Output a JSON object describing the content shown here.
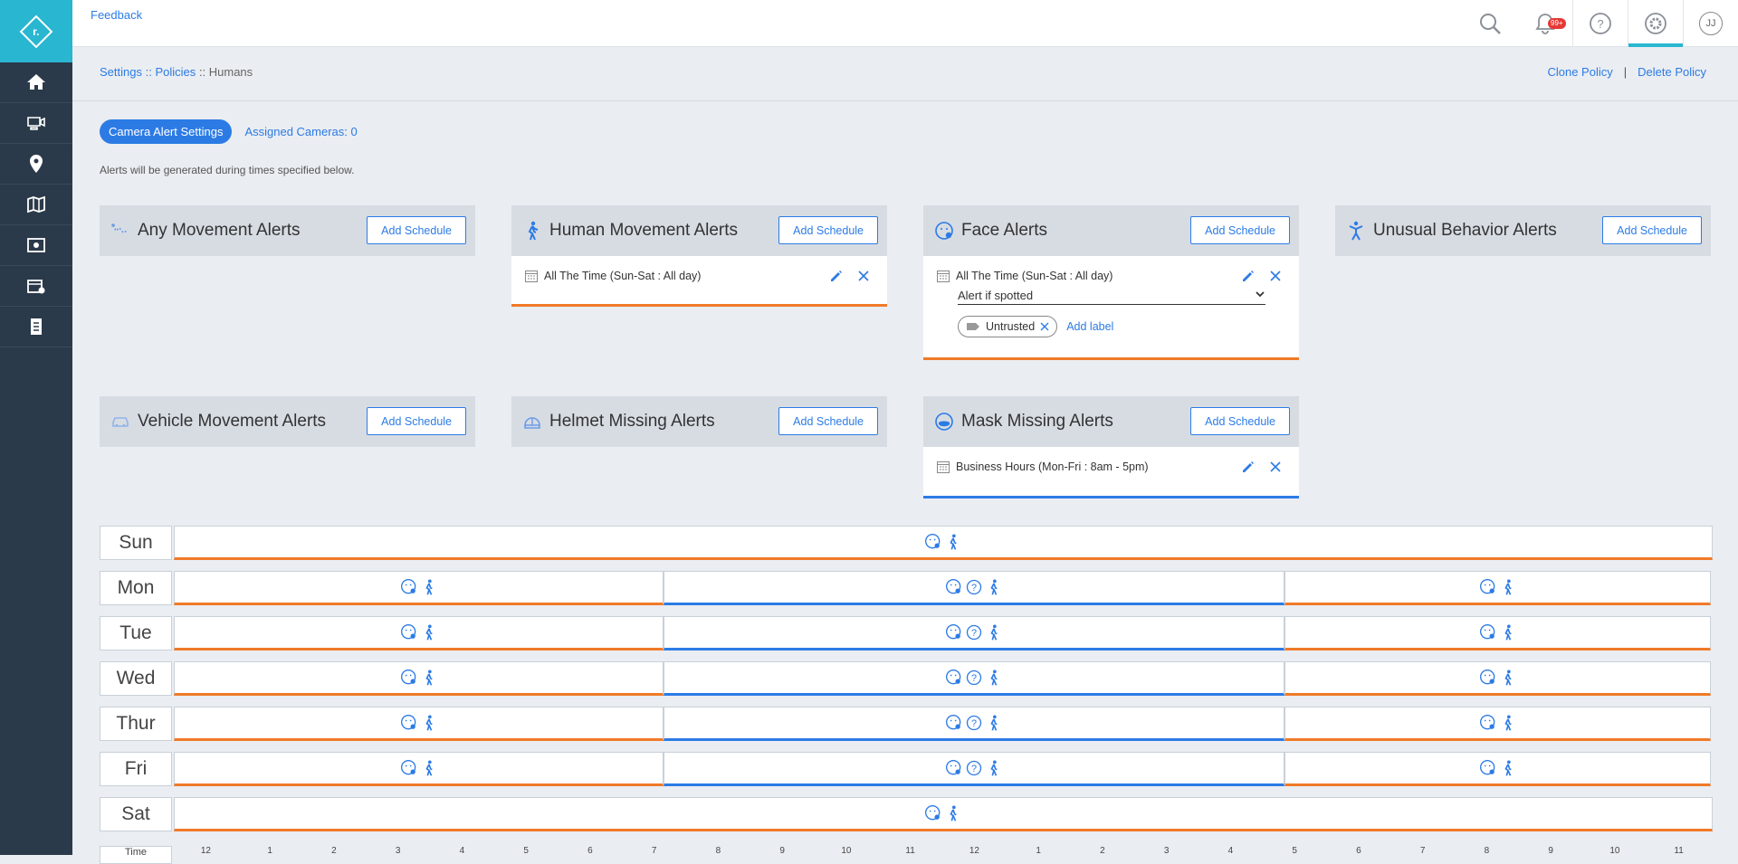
{
  "app": {
    "logo_text": "r."
  },
  "nav": [
    {
      "icon": "home-icon"
    },
    {
      "icon": "camera-devices-icon"
    },
    {
      "icon": "location-pin-icon"
    },
    {
      "icon": "map-icon"
    },
    {
      "icon": "video-wall-icon"
    },
    {
      "icon": "video-settings-icon"
    },
    {
      "icon": "reports-icon"
    }
  ],
  "topbar": {
    "feedback": "Feedback",
    "notification_badge": "99+",
    "avatar": "JJ"
  },
  "breadcrumb": {
    "settings": "Settings",
    "sep1": "::",
    "policies": "Policies",
    "sep2": "::",
    "current": "Humans"
  },
  "page_actions": {
    "clone": "Clone Policy",
    "sep": "|",
    "delete": "Delete Policy"
  },
  "tabs": {
    "active": "Camera Alert Settings",
    "assigned": "Assigned Cameras: 0"
  },
  "note": "Alerts will be generated during times specified below.",
  "cards": [
    {
      "title": "Any Movement Alerts",
      "button": "Add Schedule",
      "icon": "movement-path-icon"
    },
    {
      "title": "Human Movement Alerts",
      "button": "Add Schedule",
      "icon": "walking-person-icon",
      "schedule": "All The Time (Sun-Sat : All day)",
      "accent": "#f07a28"
    },
    {
      "title": "Face Alerts",
      "button": "Add Schedule",
      "icon": "face-icon",
      "schedule": "All The Time (Sun-Sat : All day)",
      "select": "Alert if spotted",
      "chip": "Untrusted",
      "add_label": "Add label",
      "accent": "#f07a28"
    },
    {
      "title": "Unusual Behavior Alerts",
      "button": "Add Schedule",
      "icon": "unusual-behavior-icon"
    },
    {
      "title": "Vehicle Movement Alerts",
      "button": "Add Schedule",
      "icon": "car-icon"
    },
    {
      "title": "Helmet Missing Alerts",
      "button": "Add Schedule",
      "icon": "helmet-icon"
    },
    {
      "title": "Mask Missing Alerts",
      "button": "Add Schedule",
      "icon": "mask-icon",
      "schedule": "Business Hours (Mon-Fri : 8am - 5pm)",
      "accent": "#2c7be5"
    }
  ],
  "timeline": {
    "days": [
      "Sun",
      "Mon",
      "Tue",
      "Wed",
      "Thur",
      "Fri",
      "Sat"
    ],
    "time_label": "Time",
    "hours": [
      "12",
      "1",
      "2",
      "3",
      "4",
      "5",
      "6",
      "7",
      "8",
      "9",
      "10",
      "11",
      "12",
      "1",
      "2",
      "3",
      "4",
      "5",
      "6",
      "7",
      "8",
      "9",
      "10",
      "11"
    ]
  }
}
